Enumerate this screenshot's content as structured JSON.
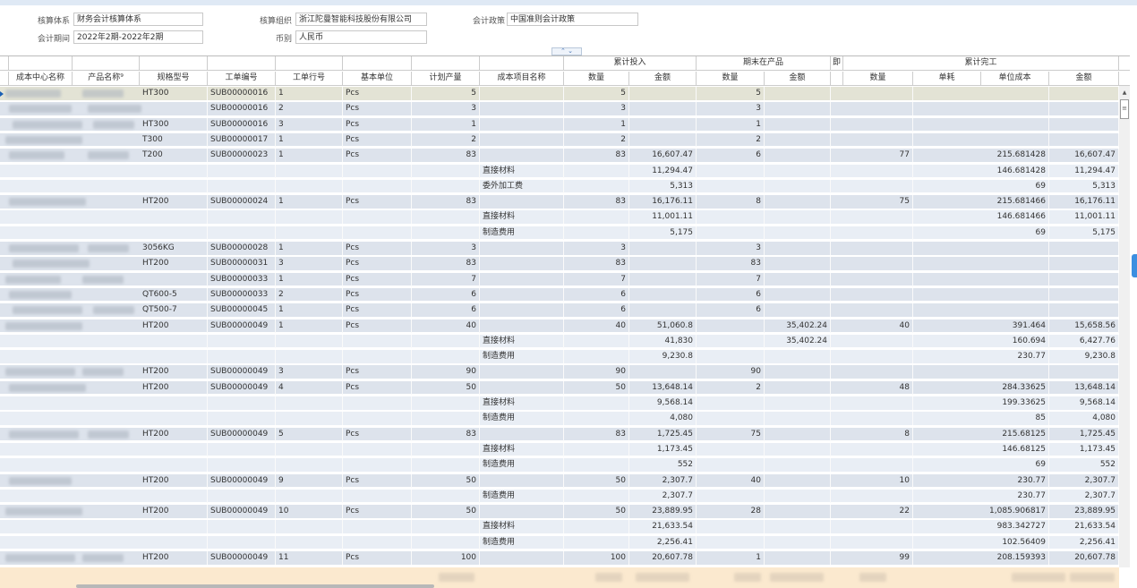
{
  "form": {
    "accounting_system": {
      "label": "核算体系",
      "value": "财务会计核算体系"
    },
    "accounting_org": {
      "label": "核算组织",
      "value": "浙江陀曼智能科技股份有限公司"
    },
    "accounting_policy": {
      "label": "会计政策",
      "value": "中国准则会计政策"
    },
    "period": {
      "label": "会计期间",
      "value": "2022年2期-2022年2期"
    },
    "currency": {
      "label": "币别",
      "value": "人民币"
    }
  },
  "groups": {
    "accum_input": "累计投入",
    "wip_end": "期末在产品",
    "truncated": "即",
    "accum_done": "累计完工"
  },
  "columns": {
    "cost_center": "成本中心名称",
    "product": "产品名称",
    "spec": "规格型号",
    "order_no": "工单编号",
    "line": "工单行号",
    "unit": "基本单位",
    "plan_qty": "计划产量",
    "cost_item": "成本项目名称",
    "in_qty": "数量",
    "in_amt": "金额",
    "wip_qty": "数量",
    "wip_amt": "金额",
    "done_qty": "数量",
    "consumption": "单耗",
    "unit_cost": "单位成本",
    "done_amt": "金额"
  },
  "rows": [
    {
      "t": "sel",
      "spec": "HT300",
      "order": "SUB00000016",
      "line": "1",
      "unit": "Pcs",
      "plan": "5",
      "item": "",
      "iq": "5",
      "ia": "",
      "wq": "5",
      "wa": "",
      "dq": "",
      "uc": "",
      "da": ""
    },
    {
      "t": "grp",
      "spec": "",
      "order": "SUB00000016",
      "line": "2",
      "unit": "Pcs",
      "plan": "3",
      "item": "",
      "iq": "3",
      "ia": "",
      "wq": "3",
      "wa": "",
      "dq": "",
      "uc": "",
      "da": ""
    },
    {
      "t": "grp",
      "spec": "HT300",
      "order": "SUB00000016",
      "line": "3",
      "unit": "Pcs",
      "plan": "1",
      "item": "",
      "iq": "1",
      "ia": "",
      "wq": "1",
      "wa": "",
      "dq": "",
      "uc": "",
      "da": ""
    },
    {
      "t": "grp",
      "spec": "T300",
      "order": "SUB00000017",
      "line": "1",
      "unit": "Pcs",
      "plan": "2",
      "item": "",
      "iq": "2",
      "ia": "",
      "wq": "2",
      "wa": "",
      "dq": "",
      "uc": "",
      "da": ""
    },
    {
      "t": "grp",
      "spec": "T200",
      "order": "SUB00000023",
      "line": "1",
      "unit": "Pcs",
      "plan": "83",
      "item": "",
      "iq": "83",
      "ia": "16,607.47",
      "wq": "6",
      "wa": "",
      "dq": "77",
      "uc": "215.681428",
      "da": "16,607.47"
    },
    {
      "t": "sub",
      "spec": "",
      "order": "",
      "line": "",
      "unit": "",
      "plan": "",
      "item": "直接材料",
      "iq": "",
      "ia": "11,294.47",
      "wq": "",
      "wa": "",
      "dq": "",
      "uc": "146.681428",
      "da": "11,294.47"
    },
    {
      "t": "sub",
      "spec": "",
      "order": "",
      "line": "",
      "unit": "",
      "plan": "",
      "item": "委外加工费",
      "iq": "",
      "ia": "5,313",
      "wq": "",
      "wa": "",
      "dq": "",
      "uc": "69",
      "da": "5,313"
    },
    {
      "t": "grp",
      "spec": "HT200",
      "order": "SUB00000024",
      "line": "1",
      "unit": "Pcs",
      "plan": "83",
      "item": "",
      "iq": "83",
      "ia": "16,176.11",
      "wq": "8",
      "wa": "",
      "dq": "75",
      "uc": "215.681466",
      "da": "16,176.11"
    },
    {
      "t": "sub",
      "spec": "",
      "order": "",
      "line": "",
      "unit": "",
      "plan": "",
      "item": "直接材料",
      "iq": "",
      "ia": "11,001.11",
      "wq": "",
      "wa": "",
      "dq": "",
      "uc": "146.681466",
      "da": "11,001.11"
    },
    {
      "t": "sub",
      "spec": "",
      "order": "",
      "line": "",
      "unit": "",
      "plan": "",
      "item": "制造费用",
      "iq": "",
      "ia": "5,175",
      "wq": "",
      "wa": "",
      "dq": "",
      "uc": "69",
      "da": "5,175"
    },
    {
      "t": "grp",
      "spec": "3056KG",
      "order": "SUB00000028",
      "line": "1",
      "unit": "Pcs",
      "plan": "3",
      "item": "",
      "iq": "3",
      "ia": "",
      "wq": "3",
      "wa": "",
      "dq": "",
      "uc": "",
      "da": ""
    },
    {
      "t": "grp",
      "spec": "HT200",
      "order": "SUB00000031",
      "line": "3",
      "unit": "Pcs",
      "plan": "83",
      "item": "",
      "iq": "83",
      "ia": "",
      "wq": "83",
      "wa": "",
      "dq": "",
      "uc": "",
      "da": ""
    },
    {
      "t": "grp",
      "spec": "",
      "order": "SUB00000033",
      "line": "1",
      "unit": "Pcs",
      "plan": "7",
      "item": "",
      "iq": "7",
      "ia": "",
      "wq": "7",
      "wa": "",
      "dq": "",
      "uc": "",
      "da": ""
    },
    {
      "t": "grp",
      "spec": "QT600-5",
      "order": "SUB00000033",
      "line": "2",
      "unit": "Pcs",
      "plan": "6",
      "item": "",
      "iq": "6",
      "ia": "",
      "wq": "6",
      "wa": "",
      "dq": "",
      "uc": "",
      "da": ""
    },
    {
      "t": "grp",
      "spec": "QT500-7",
      "order": "SUB00000045",
      "line": "1",
      "unit": "Pcs",
      "plan": "6",
      "item": "",
      "iq": "6",
      "ia": "",
      "wq": "6",
      "wa": "",
      "dq": "",
      "uc": "",
      "da": ""
    },
    {
      "t": "grp",
      "spec": "HT200",
      "order": "SUB00000049",
      "line": "1",
      "unit": "Pcs",
      "plan": "40",
      "item": "",
      "iq": "40",
      "ia": "51,060.8",
      "wq": "",
      "wa": "35,402.24",
      "dq": "40",
      "uc": "391.464",
      "da": "15,658.56"
    },
    {
      "t": "sub",
      "spec": "",
      "order": "",
      "line": "",
      "unit": "",
      "plan": "",
      "item": "直接材料",
      "iq": "",
      "ia": "41,830",
      "wq": "",
      "wa": "35,402.24",
      "dq": "",
      "uc": "160.694",
      "da": "6,427.76"
    },
    {
      "t": "sub",
      "spec": "",
      "order": "",
      "line": "",
      "unit": "",
      "plan": "",
      "item": "制造费用",
      "iq": "",
      "ia": "9,230.8",
      "wq": "",
      "wa": "",
      "dq": "",
      "uc": "230.77",
      "da": "9,230.8"
    },
    {
      "t": "grp",
      "spec": "HT200",
      "order": "SUB00000049",
      "line": "3",
      "unit": "Pcs",
      "plan": "90",
      "item": "",
      "iq": "90",
      "ia": "",
      "wq": "90",
      "wa": "",
      "dq": "",
      "uc": "",
      "da": ""
    },
    {
      "t": "grp",
      "spec": "HT200",
      "order": "SUB00000049",
      "line": "4",
      "unit": "Pcs",
      "plan": "50",
      "item": "",
      "iq": "50",
      "ia": "13,648.14",
      "wq": "2",
      "wa": "",
      "dq": "48",
      "uc": "284.33625",
      "da": "13,648.14"
    },
    {
      "t": "sub",
      "spec": "",
      "order": "",
      "line": "",
      "unit": "",
      "plan": "",
      "item": "直接材料",
      "iq": "",
      "ia": "9,568.14",
      "wq": "",
      "wa": "",
      "dq": "",
      "uc": "199.33625",
      "da": "9,568.14"
    },
    {
      "t": "sub",
      "spec": "",
      "order": "",
      "line": "",
      "unit": "",
      "plan": "",
      "item": "制造费用",
      "iq": "",
      "ia": "4,080",
      "wq": "",
      "wa": "",
      "dq": "",
      "uc": "85",
      "da": "4,080"
    },
    {
      "t": "grp",
      "spec": "HT200",
      "order": "SUB00000049",
      "line": "5",
      "unit": "Pcs",
      "plan": "83",
      "item": "",
      "iq": "83",
      "ia": "1,725.45",
      "wq": "75",
      "wa": "",
      "dq": "8",
      "uc": "215.68125",
      "da": "1,725.45"
    },
    {
      "t": "sub",
      "spec": "",
      "order": "",
      "line": "",
      "unit": "",
      "plan": "",
      "item": "直接材料",
      "iq": "",
      "ia": "1,173.45",
      "wq": "",
      "wa": "",
      "dq": "",
      "uc": "146.68125",
      "da": "1,173.45"
    },
    {
      "t": "sub",
      "spec": "",
      "order": "",
      "line": "",
      "unit": "",
      "plan": "",
      "item": "制造费用",
      "iq": "",
      "ia": "552",
      "wq": "",
      "wa": "",
      "dq": "",
      "uc": "69",
      "da": "552"
    },
    {
      "t": "grp",
      "spec": "HT200",
      "order": "SUB00000049",
      "line": "9",
      "unit": "Pcs",
      "plan": "50",
      "item": "",
      "iq": "50",
      "ia": "2,307.7",
      "wq": "40",
      "wa": "",
      "dq": "10",
      "uc": "230.77",
      "da": "2,307.7"
    },
    {
      "t": "sub",
      "spec": "",
      "order": "",
      "line": "",
      "unit": "",
      "plan": "",
      "item": "制造费用",
      "iq": "",
      "ia": "2,307.7",
      "wq": "",
      "wa": "",
      "dq": "",
      "uc": "230.77",
      "da": "2,307.7"
    },
    {
      "t": "grp",
      "spec": "HT200",
      "order": "SUB00000049",
      "line": "10",
      "unit": "Pcs",
      "plan": "50",
      "item": "",
      "iq": "50",
      "ia": "23,889.95",
      "wq": "28",
      "wa": "",
      "dq": "22",
      "uc": "1,085.906817",
      "da": "23,889.95"
    },
    {
      "t": "sub",
      "spec": "",
      "order": "",
      "line": "",
      "unit": "",
      "plan": "",
      "item": "直接材料",
      "iq": "",
      "ia": "21,633.54",
      "wq": "",
      "wa": "",
      "dq": "",
      "uc": "983.342727",
      "da": "21,633.54"
    },
    {
      "t": "sub",
      "spec": "",
      "order": "",
      "line": "",
      "unit": "",
      "plan": "",
      "item": "制造费用",
      "iq": "",
      "ia": "2,256.41",
      "wq": "",
      "wa": "",
      "dq": "",
      "uc": "102.56409",
      "da": "2,256.41"
    },
    {
      "t": "grp",
      "spec": "HT200",
      "order": "SUB00000049",
      "line": "11",
      "unit": "Pcs",
      "plan": "100",
      "item": "",
      "iq": "100",
      "ia": "20,607.78",
      "wq": "1",
      "wa": "",
      "dq": "99",
      "uc": "208.159393",
      "da": "20,607.78"
    }
  ],
  "colors": {
    "group_row": "#dde3ec",
    "sub_row": "#e9eef5",
    "selected_row": "#e3e3d5",
    "footer": "#fbe9cf",
    "accent": "#3c8fe0"
  }
}
